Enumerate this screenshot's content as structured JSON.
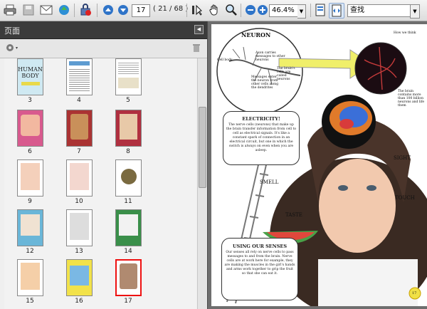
{
  "toolbar": {
    "current_page": "17",
    "page_count": "( 21 / 68 )",
    "zoom": "46.4%",
    "find_text": "查找"
  },
  "pane": {
    "title": "页面"
  },
  "thumbnails": [
    {
      "label": "3",
      "title": "HUMAN BODY"
    },
    {
      "label": "4"
    },
    {
      "label": "5"
    },
    {
      "label": "6"
    },
    {
      "label": "7"
    },
    {
      "label": "8"
    },
    {
      "label": "9"
    },
    {
      "label": "10"
    },
    {
      "label": "11"
    },
    {
      "label": "12"
    },
    {
      "label": "13"
    },
    {
      "label": "14"
    },
    {
      "label": "15"
    },
    {
      "label": "16"
    },
    {
      "label": "17"
    }
  ],
  "page": {
    "neuron_title": "NEURON",
    "neuron_notes": [
      "Cell body",
      "Axon carries messages to other neurons",
      "The brain's cells are called neurons",
      "Messages enter the neuron from other cells along the dendrites"
    ],
    "brain_note_top": "How we think",
    "brain_note_right": "The brain contains more than 100 billion neurons and life them",
    "electricity_title": "ELECTRICITY!",
    "electricity_text": "The nerve cells (neurons) that make up the brain transfer information from cell to cell as electrical signals. It's like a constant spark of connection in an electrical circuit, but one in which the switch is always on even when you are asleep.",
    "senses_title": "USING OUR SENSES",
    "senses_text": "Our senses all rely on nerve cells to pass messages to and from the brain. Nerve cells are at work here for example, they are making the muscles in the girl's hands and arms work together to grip the fruit so that she can eat it.",
    "label_sight": "SIGHT",
    "label_smell": "SMELL",
    "label_touch": "TOUCH",
    "label_taste": "TASTE",
    "page_number": "17"
  }
}
